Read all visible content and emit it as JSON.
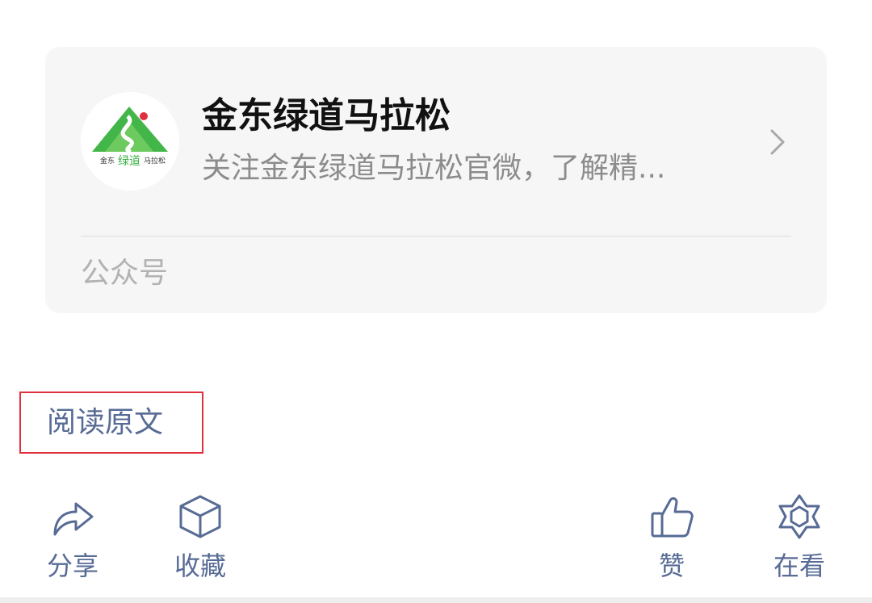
{
  "account_card": {
    "logo_text_left": "金东",
    "logo_text_mid": "绿道",
    "logo_text_right": "马拉松",
    "name": "金东绿道马拉松",
    "description": "关注金东绿道马拉松官微，了解精...",
    "type_label": "公众号",
    "chevron_icon": "chevron-right-icon"
  },
  "read_original": {
    "label": "阅读原文",
    "highlight_color": "#e0303e"
  },
  "actions": {
    "share": {
      "label": "分享",
      "icon": "share-arrow-icon"
    },
    "favorite": {
      "label": "收藏",
      "icon": "cube-icon"
    },
    "like": {
      "label": "赞",
      "icon": "thumbs-up-icon"
    },
    "wow": {
      "label": "在看",
      "icon": "star-flower-icon"
    }
  },
  "colors": {
    "link_blue": "#576b95",
    "card_bg": "#f6f6f6",
    "title": "#111111",
    "secondary_text": "#8c8c8c",
    "logo_green": "#3cb043"
  }
}
